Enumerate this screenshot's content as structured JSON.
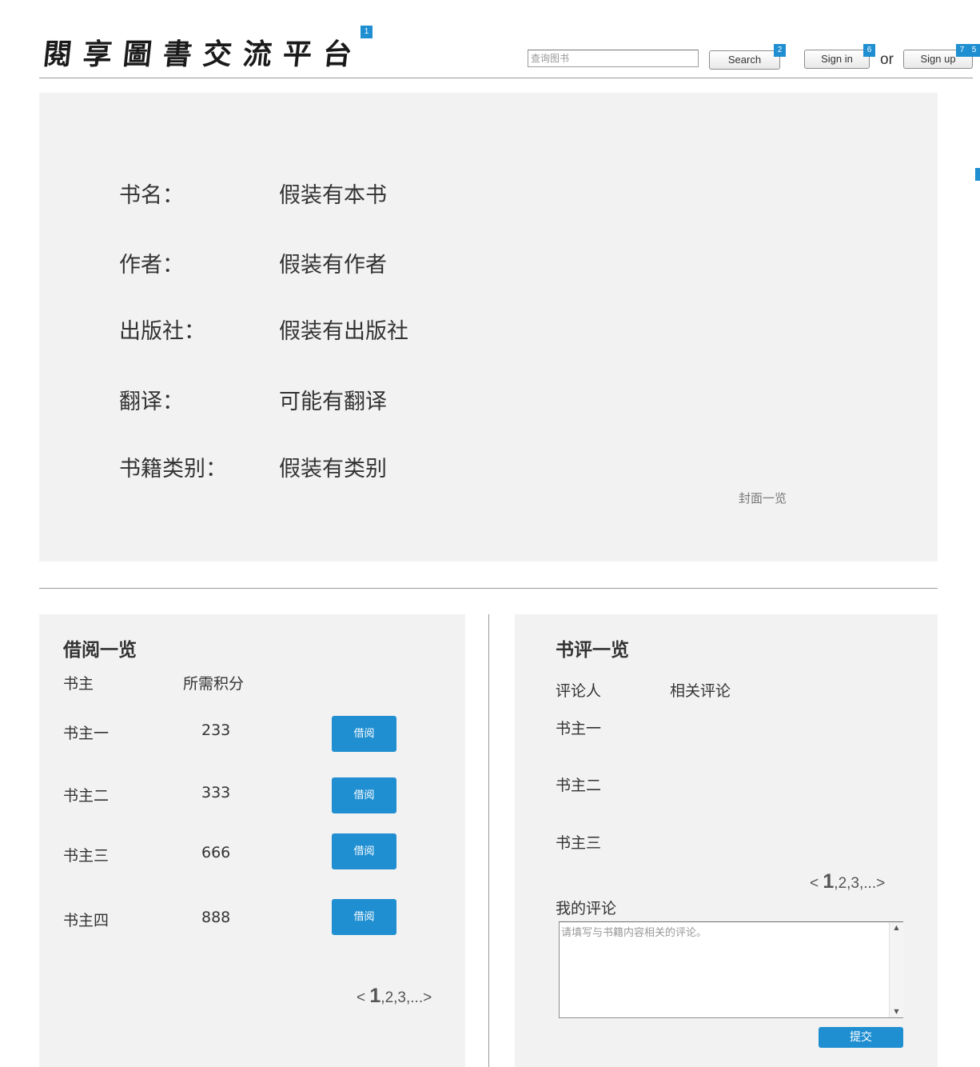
{
  "header": {
    "logo_text": "閱享圖書交流平台",
    "search": {
      "placeholder": "查询图书",
      "button_label": "Search"
    },
    "sign_in_label": "Sign in",
    "or_text": "or",
    "sign_up_label": "Sign up",
    "markers": [
      "1",
      "2",
      "6",
      "7",
      "5"
    ]
  },
  "book": {
    "fields": [
      {
        "label": "书名：",
        "value": "假装有本书"
      },
      {
        "label": "作者：",
        "value": "假装有作者"
      },
      {
        "label": "出版社：",
        "value": "假装有出版社"
      },
      {
        "label": "翻译：",
        "value": "可能有翻译"
      },
      {
        "label": "书籍类别：",
        "value": "假装有类别"
      }
    ],
    "cover_link": "封面一览"
  },
  "borrow": {
    "title": "借阅一览",
    "columns": [
      "书主",
      "所需积分"
    ],
    "rows": [
      {
        "owner": "书主一",
        "points": "233",
        "button": "借阅"
      },
      {
        "owner": "书主二",
        "points": "333",
        "button": "借阅"
      },
      {
        "owner": "书主三",
        "points": "666",
        "button": "借阅"
      },
      {
        "owner": "书主四",
        "points": "888",
        "button": "借阅"
      }
    ],
    "pager": {
      "prev": "<",
      "current": "1",
      "rest": ",2,3,...",
      "next": ">"
    }
  },
  "reviews": {
    "title": "书评一览",
    "columns": [
      "评论人",
      "相关评论"
    ],
    "rows": [
      "书主一",
      "书主二",
      "书主三"
    ],
    "pager": {
      "prev": "<",
      "current": "1",
      "rest": ",2,3,...",
      "next": ">"
    },
    "my_comment_label": "我的评论",
    "comment_placeholder": "请填写与书籍内容相关的评论。",
    "submit_label": "提交"
  },
  "colors": {
    "accent": "#1f8fd1",
    "panel_bg": "#f2f2f2",
    "text": "#333333",
    "rule": "#999999"
  }
}
